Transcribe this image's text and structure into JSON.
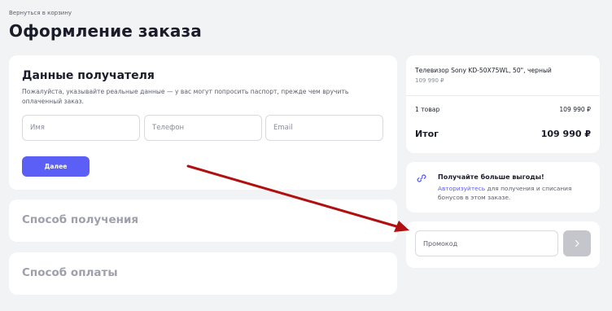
{
  "header": {
    "back_link": "Вернуться в корзину",
    "title": "Оформление заказа"
  },
  "recipient": {
    "title": "Данные получателя",
    "hint": "Пожалуйста, указывайте реальные данные — у вас могут попросить паспорт, прежде чем вручить оплаченный заказ.",
    "fields": {
      "name_placeholder": "Имя",
      "phone_placeholder": "Телефон",
      "email_placeholder": "Email"
    },
    "next_button": "Далее"
  },
  "delivery": {
    "title": "Способ получения"
  },
  "payment": {
    "title": "Способ оплаты"
  },
  "summary": {
    "product_name": "Телевизор Sony KD-50X75WL, 50\", черный",
    "product_price": "109 990 ₽",
    "items_count": "1 товар",
    "items_sum": "109 990 ₽",
    "total_label": "Итог",
    "total_value": "109 990 ₽"
  },
  "bonus": {
    "title": "Получайте больше выгоды!",
    "link": "Авторизуйтесь",
    "text": " для получения и списания бонусов в этом заказе.",
    "icon": "link-icon"
  },
  "promo": {
    "placeholder": "Промокод",
    "apply_icon": "chevron-right-icon"
  },
  "annotation": {
    "color": "#b01010"
  },
  "colors": {
    "accent": "#5b5ff5",
    "background": "#f2f3f5",
    "card": "#ffffff",
    "muted_heading": "#9ea0ab",
    "disabled_button": "#c4c6cc"
  }
}
